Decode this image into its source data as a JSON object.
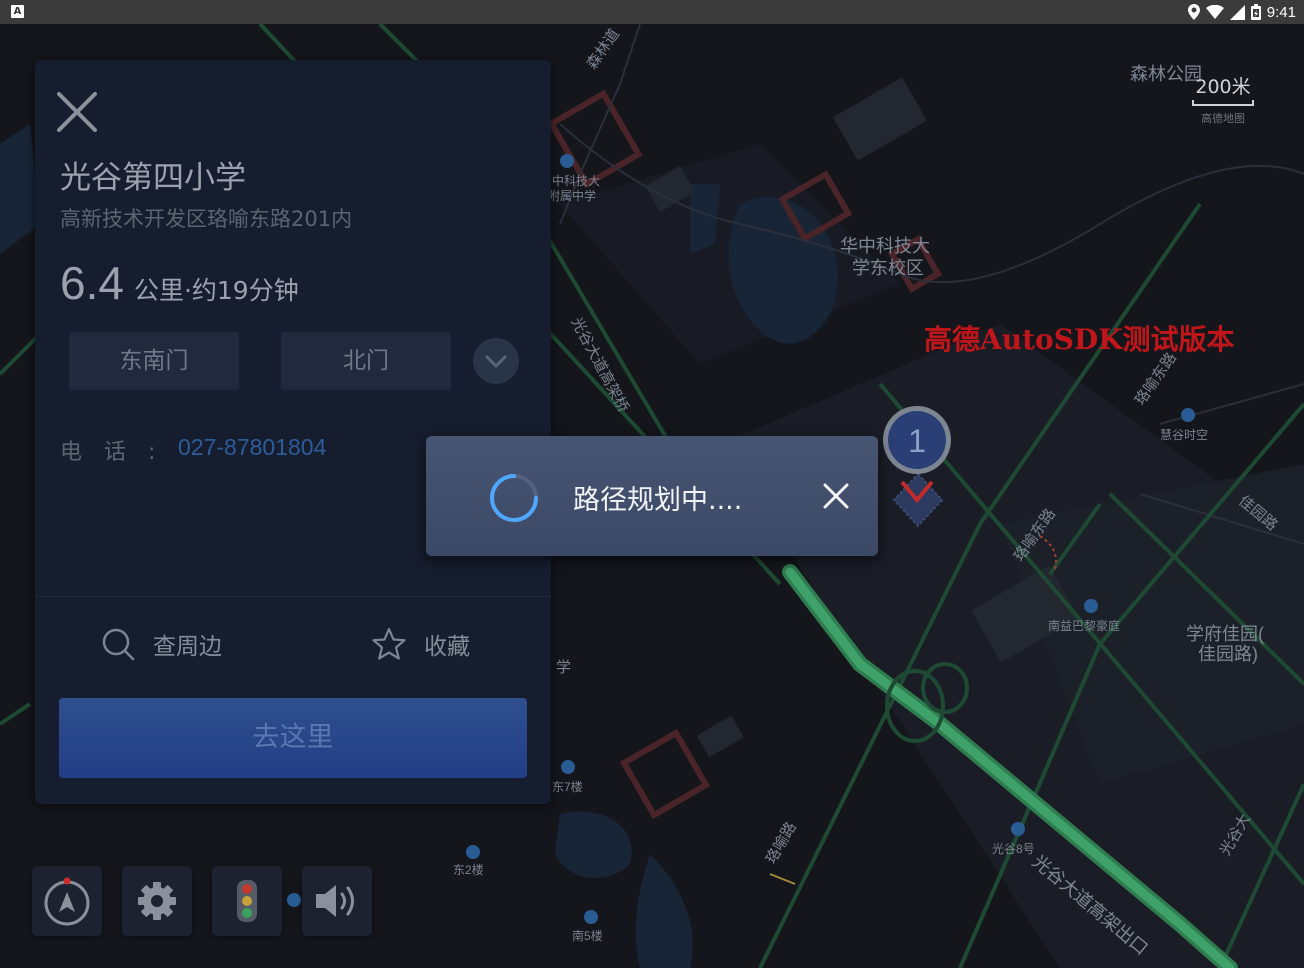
{
  "status_bar": {
    "time": "9:41"
  },
  "map": {
    "watermark": "高德AutoSDK测试版本",
    "scale": {
      "label": "200米",
      "brand": "高德地图"
    },
    "marker_number": "1",
    "labels": {
      "senlin_road": "森林道",
      "senlin_park": "森林公园",
      "hust_affiliated_1": "中科技大",
      "hust_affiliated_2": "附属中学",
      "hust_east_1": "华中科技大",
      "hust_east_2": "学东校区",
      "guanggu_overpass": "光谷大道高架桥",
      "luoyu_east_1": "珞喻东路",
      "huigu_space": "慧谷时空",
      "jiayuan_road": "佳园路",
      "luoyu_east_2": "珞喻东路",
      "nanyi_bali": "南益巴黎豪庭",
      "xuefu_1": "学府佳园(",
      "xuefu_2": "佳园路)",
      "school_frag": "学",
      "east7": "东7楼",
      "east2": "东2楼",
      "south5": "南5楼",
      "luoyu_road": "珞喻路",
      "guanggu8": "光谷8号",
      "guanggu_exit": "光谷大道高架出口",
      "guanggu_vert": "光谷大"
    }
  },
  "poi": {
    "name": "光谷第四小学",
    "address": "高新技术开发区珞喻东路201内",
    "distance_value": "6.4",
    "distance_text": "公里·约19分钟",
    "gates": [
      "东南门",
      "北门"
    ],
    "phone_label": "电话:",
    "phone": "027-87801804",
    "actions": {
      "nearby": "查周边",
      "favorite": "收藏"
    },
    "go_label": "去这里"
  },
  "dialog": {
    "message": "路径规划中...."
  }
}
